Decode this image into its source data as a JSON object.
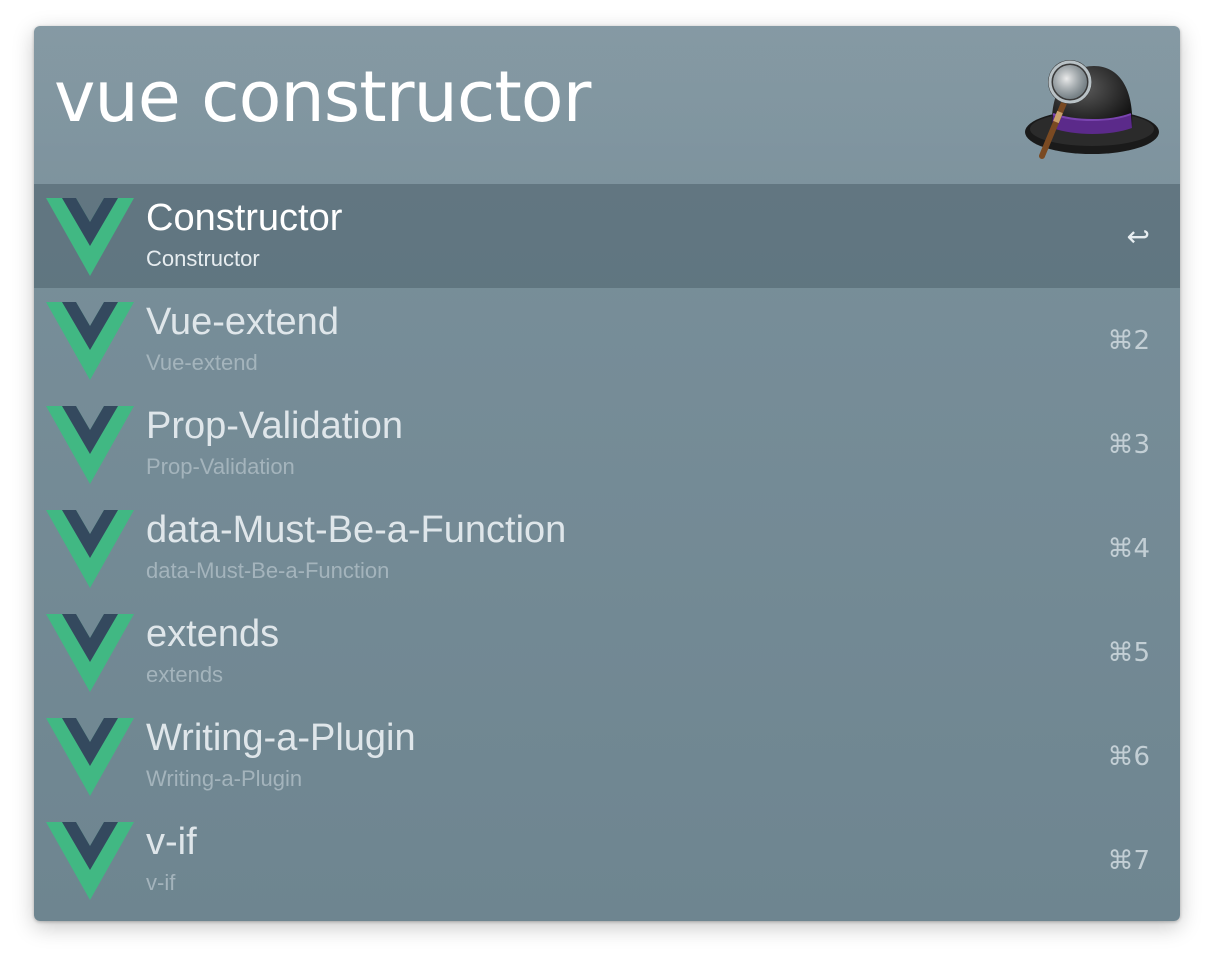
{
  "launcher": {
    "query": "vue constructor",
    "logo_icon": "alfred-hat-magnifier-icon"
  },
  "results": [
    {
      "title": "Constructor",
      "subtitle": "Constructor",
      "shortcut": "↩",
      "selected": true,
      "icon": "vue-logo-icon"
    },
    {
      "title": "Vue-extend",
      "subtitle": "Vue-extend",
      "shortcut": "⌘2",
      "selected": false,
      "icon": "vue-logo-icon"
    },
    {
      "title": "Prop-Validation",
      "subtitle": "Prop-Validation",
      "shortcut": "⌘3",
      "selected": false,
      "icon": "vue-logo-icon"
    },
    {
      "title": "data-Must-Be-a-Function",
      "subtitle": "data-Must-Be-a-Function",
      "shortcut": "⌘4",
      "selected": false,
      "icon": "vue-logo-icon"
    },
    {
      "title": "extends",
      "subtitle": "extends",
      "shortcut": "⌘5",
      "selected": false,
      "icon": "vue-logo-icon"
    },
    {
      "title": "Writing-a-Plugin",
      "subtitle": "Writing-a-Plugin",
      "shortcut": "⌘6",
      "selected": false,
      "icon": "vue-logo-icon"
    },
    {
      "title": "v-if",
      "subtitle": "v-if",
      "shortcut": "⌘7",
      "selected": false,
      "icon": "vue-logo-icon"
    }
  ],
  "colors": {
    "vue_green": "#41b883",
    "vue_dark": "#34495e",
    "window_bg": "#70868f"
  }
}
